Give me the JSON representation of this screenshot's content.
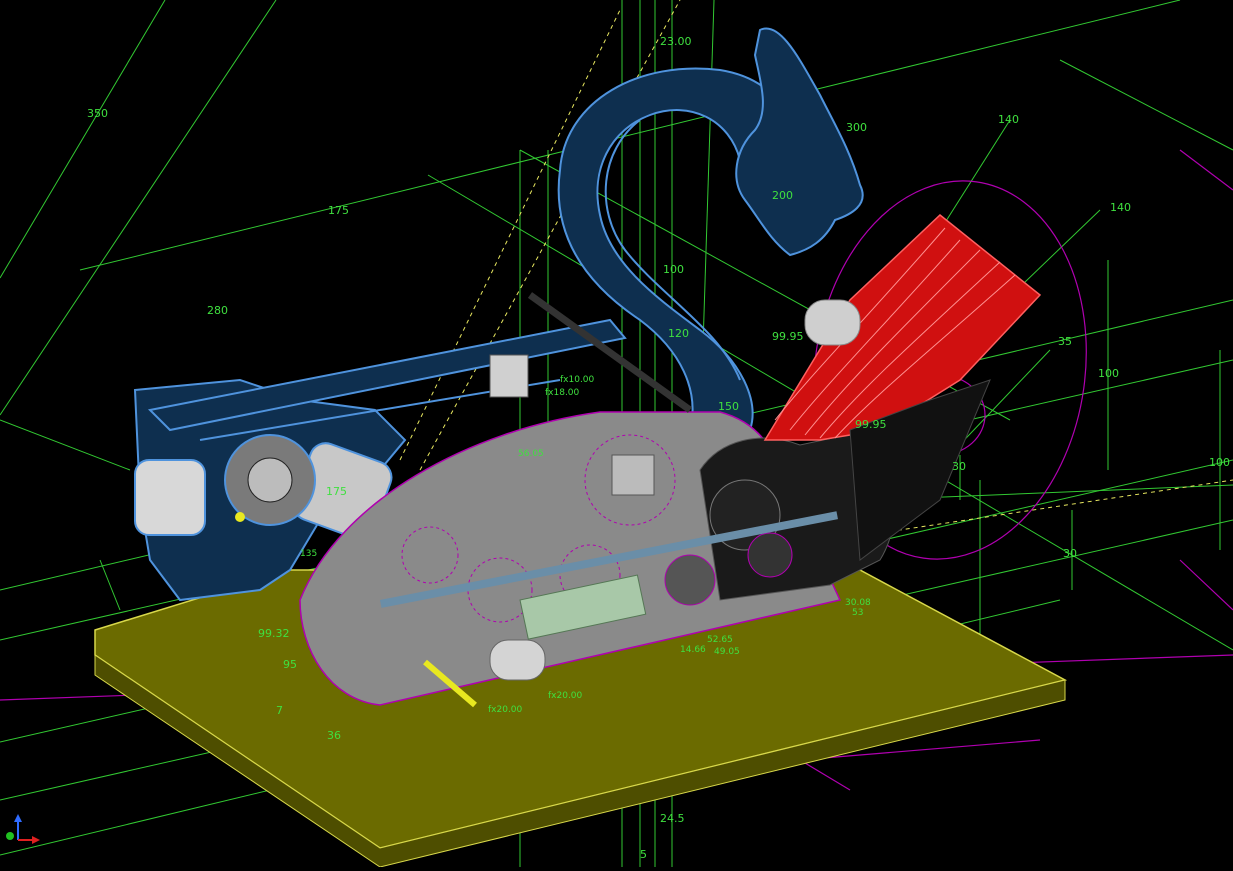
{
  "colors": {
    "background": "#000000",
    "dimension": "#3fe03f",
    "construction": "#b000b0",
    "frame": "#3d7ec8",
    "frame_fill": "#0e2f4f",
    "plate": "#6b6b00",
    "plate_edge": "#d8d84a",
    "plate_side": "#4e4e00",
    "housing": "#8a8a8a",
    "sheet": "#e02020",
    "bolt": "#e8e820",
    "metal": "#cfcfcf"
  },
  "dimensions": {
    "d350": "350",
    "d175": "175",
    "d280": "280",
    "d2300": "23.00",
    "d300": "300",
    "d140a": "140",
    "d140b": "140",
    "d200": "200",
    "d100a": "100",
    "d120": "120",
    "d9995a": "99.95",
    "d35": "35",
    "d100b": "100",
    "d100c": "100",
    "d9995b": "99.95",
    "d30a": "30",
    "d30b": "30",
    "d150": "150",
    "d175b": "175",
    "d9932": "99.32",
    "d95": "95",
    "d36": "36",
    "d7": "7",
    "d245": "24.5",
    "d5": "5",
    "dfx2000a": "fx20.00",
    "dfx2000b": "fx20.00",
    "dfx1000": "fx10.00",
    "dfx1800": "fx18.00",
    "d3008": "30.08",
    "d5265": "52.65",
    "d1466": "14.66",
    "d4905": "49.05",
    "d53": "53",
    "d5605": "56.05",
    "d135": "135"
  },
  "axis_triad": {
    "icon": "xyz-axis-triad-icon"
  }
}
